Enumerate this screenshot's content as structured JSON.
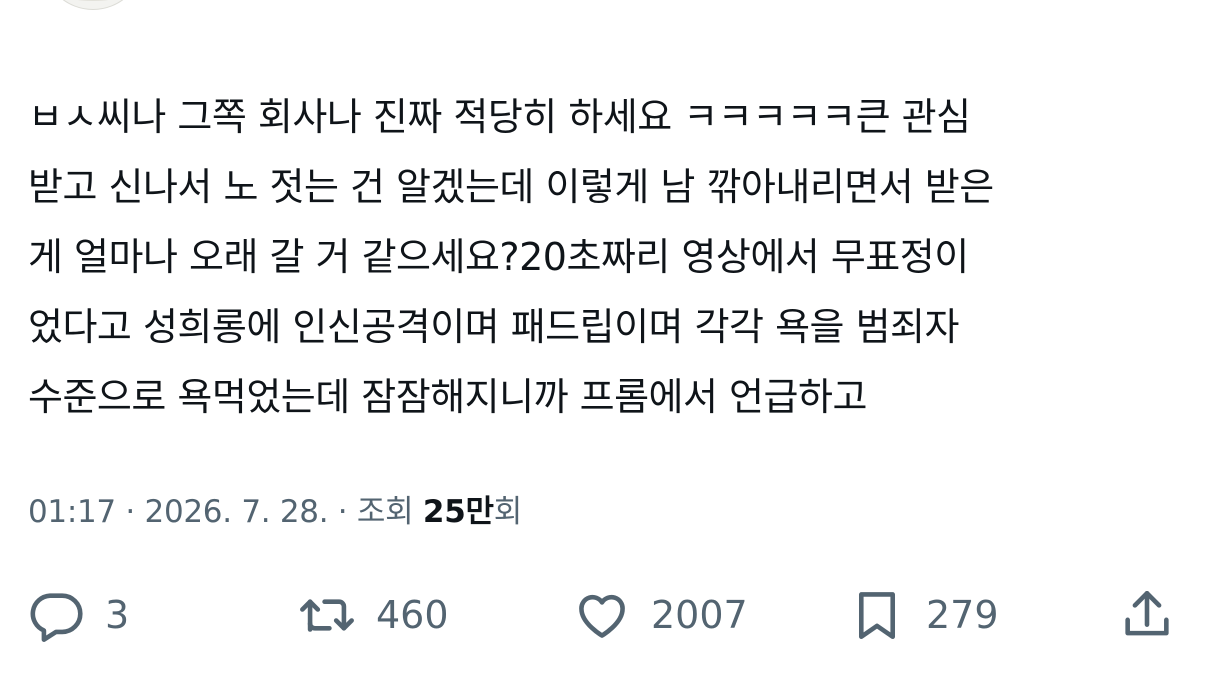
{
  "tweet": {
    "lines": [
      "ㅂㅅ씨나 그쪽 회사나 진짜 적당히 하세요 ㅋㅋㅋㅋㅋ큰 관심",
      "받고 신나서 노 젓는 건 알겠는데 이렇게 남 깎아내리면서 받은",
      "게 얼마나 오래 갈 거 같으세요?20초짜리 영상에서 무표정이",
      "었다고 성희롱에 인신공격이며 패드립이며 각각 욕을 범죄자",
      "수준으로 욕먹었는데 잠잠해지니까 프롬에서 언급하고"
    ]
  },
  "meta": {
    "time": "01:17",
    "separator1": " · ",
    "date": "2026. 7. 28.",
    "separator2": " · ",
    "views_label": "조회 ",
    "views_count": "25만",
    "views_suffix": "회"
  },
  "actions": {
    "reply": {
      "icon": "reply-icon",
      "count": "3"
    },
    "retweet": {
      "icon": "retweet-icon",
      "count": "460"
    },
    "like": {
      "icon": "heart-icon",
      "count": "2007"
    },
    "bookmark": {
      "icon": "bookmark-icon",
      "count": "279"
    },
    "share": {
      "icon": "share-icon"
    }
  },
  "colors": {
    "text": "#0f1419",
    "secondary": "#536471",
    "background": "#ffffff"
  }
}
